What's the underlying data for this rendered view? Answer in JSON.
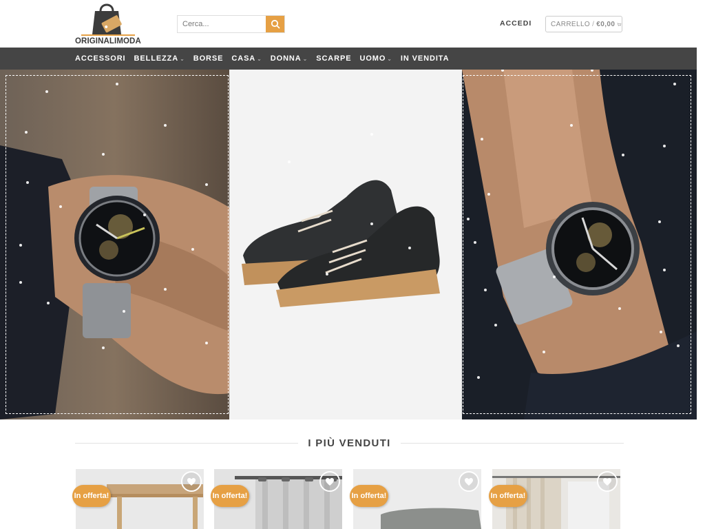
{
  "header": {
    "logo_text": "ORIGINALIMODA",
    "search_placeholder": "Cerca...",
    "login_label": "ACCEDI",
    "cart_label": "CARRELLO",
    "cart_separator": "/",
    "cart_amount": "€0,00"
  },
  "nav": {
    "items": [
      {
        "label": "ACCESSORI",
        "has_submenu": false
      },
      {
        "label": "BELLEZZA",
        "has_submenu": true
      },
      {
        "label": "BORSE",
        "has_submenu": false
      },
      {
        "label": "CASA",
        "has_submenu": true
      },
      {
        "label": "DONNA",
        "has_submenu": true
      },
      {
        "label": "SCARPE",
        "has_submenu": false
      },
      {
        "label": "UOMO",
        "has_submenu": true
      },
      {
        "label": "IN VENDITA",
        "has_submenu": false
      }
    ]
  },
  "bestsellers": {
    "title": "I PIÙ VENDUTI",
    "products": [
      {
        "badge": "In offerta!"
      },
      {
        "badge": "In offerta!"
      },
      {
        "badge": "In offerta!"
      },
      {
        "badge": "In offerta!"
      }
    ]
  },
  "colors": {
    "accent": "#e6a044",
    "nav_bg": "#454545"
  }
}
